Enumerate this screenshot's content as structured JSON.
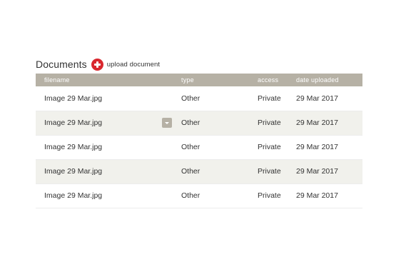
{
  "header": {
    "title": "Documents",
    "upload_label": "upload document",
    "upload_icon": "plus-circle-icon",
    "accent_color": "#d9272e"
  },
  "table": {
    "columns": {
      "filename": "filename",
      "type": "type",
      "access": "access",
      "date": "date uploaded"
    },
    "header_color": "#b6b1a5",
    "row_menu_icon": "chevron-down-icon",
    "rows": [
      {
        "filename": "Image 29 Mar.jpg",
        "type": "Other",
        "access": "Private",
        "date": "29 Mar 2017"
      },
      {
        "filename": "Image 29 Mar.jpg",
        "type": "Other",
        "access": "Private",
        "date": "29 Mar 2017"
      },
      {
        "filename": "Image 29 Mar.jpg",
        "type": "Other",
        "access": "Private",
        "date": "29 Mar 2017"
      },
      {
        "filename": "Image 29 Mar.jpg",
        "type": "Other",
        "access": "Private",
        "date": "29 Mar 2017"
      },
      {
        "filename": "Image 29 Mar.jpg",
        "type": "Other",
        "access": "Private",
        "date": "29 Mar 2017"
      }
    ]
  }
}
